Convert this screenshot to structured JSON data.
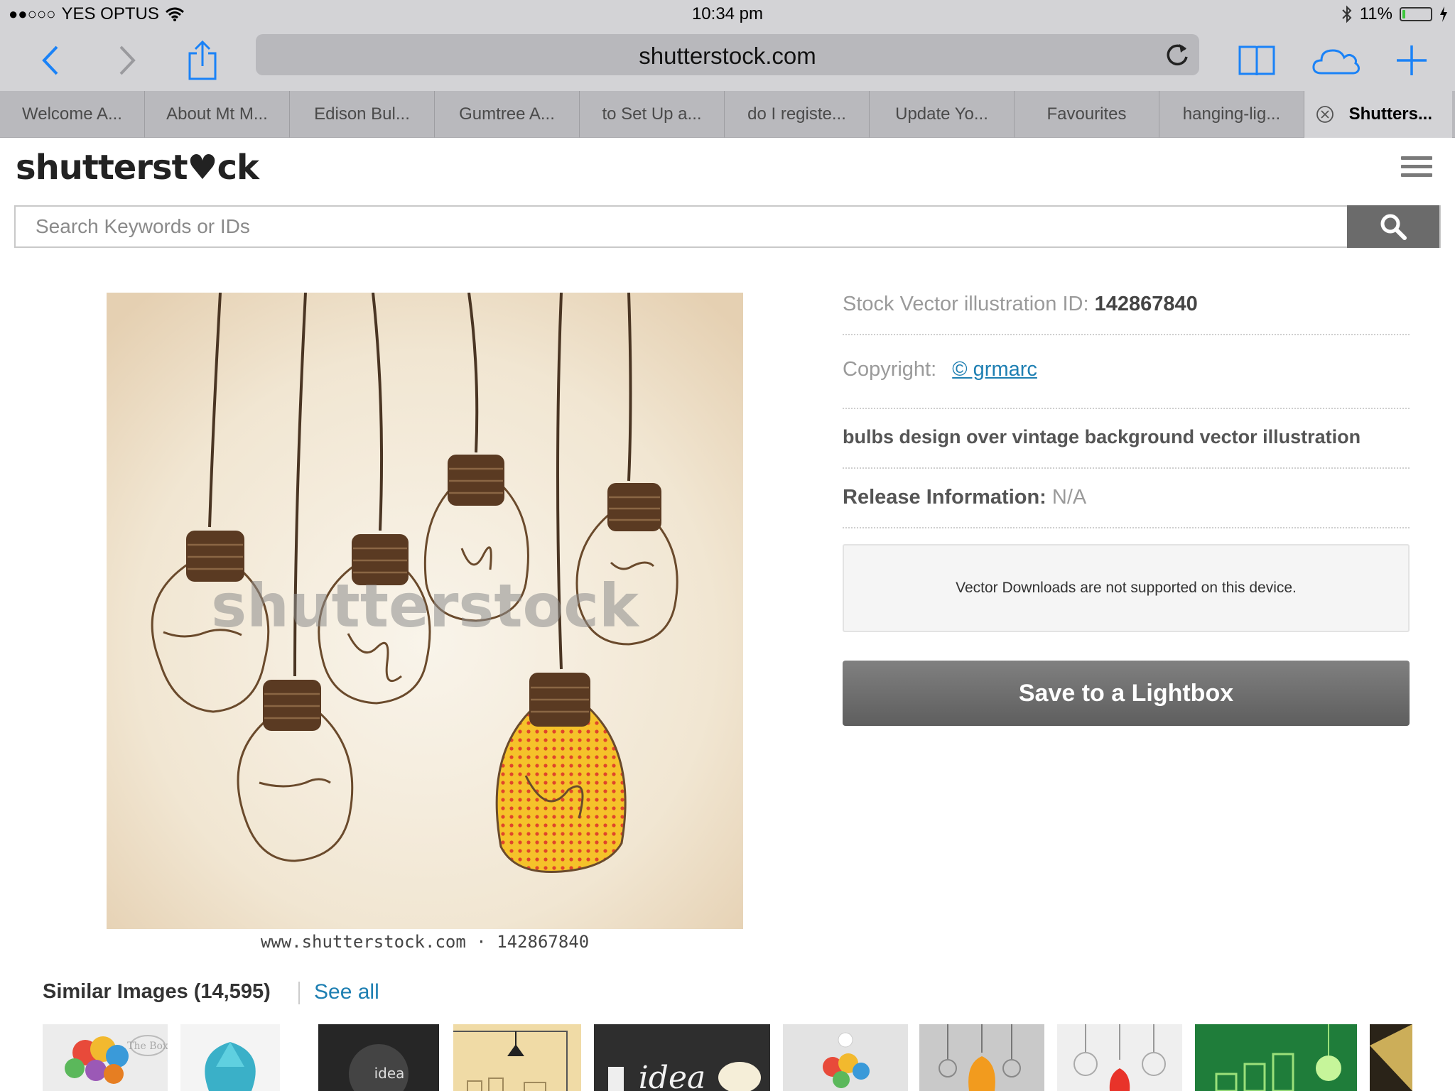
{
  "status": {
    "signal": "●●○○○",
    "carrier": "YES OPTUS",
    "time": "10:34 pm",
    "battery": "11%",
    "battery_level": 0.11
  },
  "browser": {
    "url": "shutterstock.com",
    "tabs": [
      {
        "label": "Welcome A..."
      },
      {
        "label": "About Mt M..."
      },
      {
        "label": "Edison Bul..."
      },
      {
        "label": "Gumtree A..."
      },
      {
        "label": "to Set Up a..."
      },
      {
        "label": "do I registe..."
      },
      {
        "label": "Update Yo..."
      },
      {
        "label": "Favourites"
      },
      {
        "label": "hanging-lig..."
      },
      {
        "label": "Shutters..."
      }
    ]
  },
  "site": {
    "logo": "shutterst♥ck",
    "search_placeholder": "Search Keywords or IDs"
  },
  "image": {
    "watermark": "shutterstock",
    "caption": "www.shutterstock.com · 142867840"
  },
  "details": {
    "id_label": "Stock Vector illustration ID:",
    "id_value": "142867840",
    "copyright_label": "Copyright:",
    "copyright_value": "© grmarc",
    "description": "bulbs design over vintage background vector illustration",
    "release_label": "Release Information:",
    "release_value": "N/A",
    "notice": "Vector Downloads are not supported on this device.",
    "lightbox_button": "Save to a Lightbox"
  },
  "similar": {
    "title": "Similar Images (14,595)",
    "see_all": "See all",
    "thumb_labels": [
      "The Box",
      "idea",
      "idea"
    ]
  },
  "colors": {
    "link": "#1e7fb2",
    "ios_blue": "#1a82f7",
    "bulb_yellow": "#f5c22a",
    "bulb_dots": "#e0452a",
    "wire": "#4a3523"
  }
}
